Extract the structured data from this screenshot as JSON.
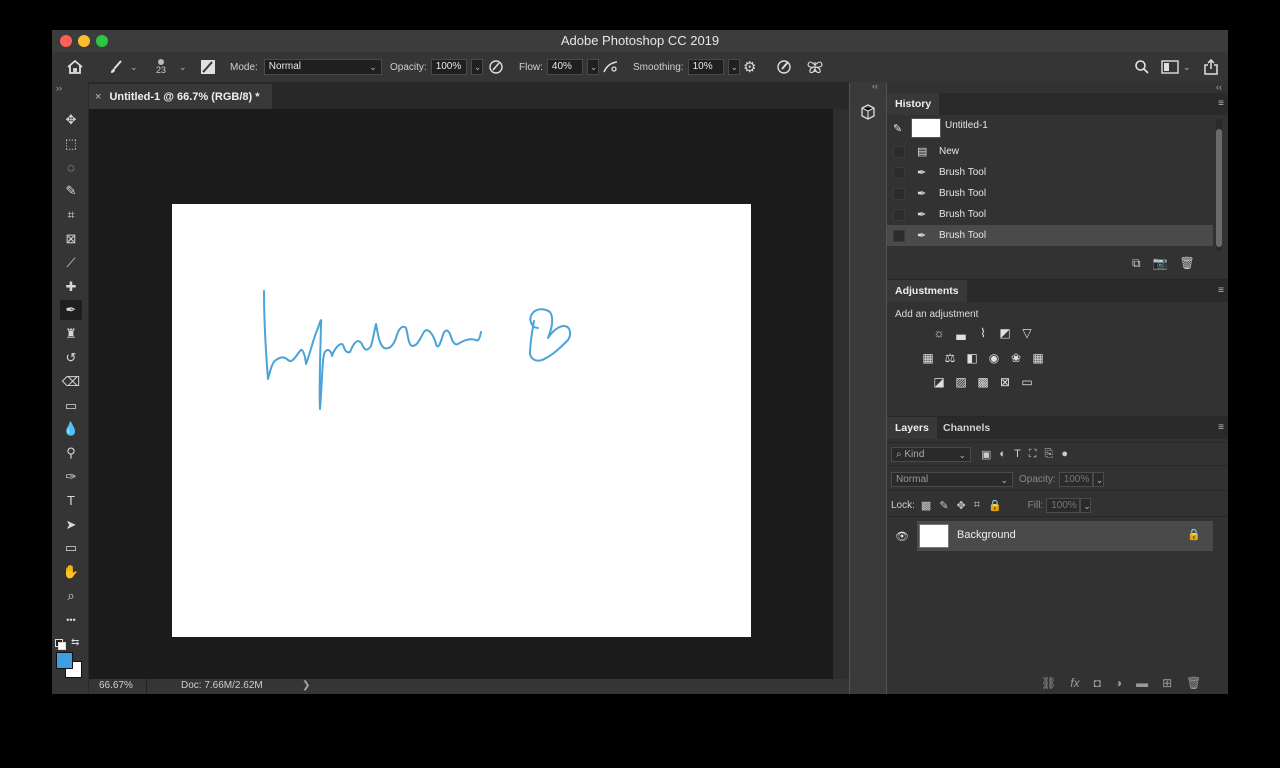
{
  "app": {
    "title": "Adobe Photoshop CC 2019",
    "traffic_lights": {
      "close": "#ff5f57",
      "minimize": "#febc2e",
      "zoom": "#28c840"
    }
  },
  "options_bar": {
    "brush_size": "23",
    "mode_label": "Mode:",
    "mode_value": "Normal",
    "opacity_label": "Opacity:",
    "opacity_value": "100%",
    "flow_label": "Flow:",
    "flow_value": "40%",
    "smoothing_label": "Smoothing:",
    "smoothing_value": "10%"
  },
  "document": {
    "tab_label": "Untitled-1 @ 66.7% (RGB/8) *",
    "tab_close": "×",
    "stroke_color": "#4aa3d9",
    "zoom": "66.67%",
    "doc_info": "Doc: 7.66M/2.62M",
    "status_arrow": "❯"
  },
  "toolbox": {
    "expand": "››",
    "foreground_color": "#3f9ee0",
    "background_color": "#ffffff",
    "tools": [
      {
        "name": "move-tool-icon",
        "glyph": "✥"
      },
      {
        "name": "marquee-tool-icon",
        "glyph": "⬚"
      },
      {
        "name": "lasso-tool-icon",
        "glyph": "◌"
      },
      {
        "name": "quick-select-tool-icon",
        "glyph": "✎"
      },
      {
        "name": "crop-tool-icon",
        "glyph": "⌗"
      },
      {
        "name": "frame-tool-icon",
        "glyph": "⊠"
      },
      {
        "name": "eyedropper-tool-icon",
        "glyph": "⟋"
      },
      {
        "name": "healing-brush-tool-icon",
        "glyph": "✚"
      },
      {
        "name": "brush-tool-icon",
        "glyph": "✒"
      },
      {
        "name": "clone-stamp-tool-icon",
        "glyph": "♜"
      },
      {
        "name": "history-brush-tool-icon",
        "glyph": "↺"
      },
      {
        "name": "eraser-tool-icon",
        "glyph": "⌫"
      },
      {
        "name": "gradient-tool-icon",
        "glyph": "▭"
      },
      {
        "name": "blur-tool-icon",
        "glyph": "💧"
      },
      {
        "name": "dodge-tool-icon",
        "glyph": "⚲"
      },
      {
        "name": "pen-tool-icon",
        "glyph": "✑"
      },
      {
        "name": "type-tool-icon",
        "glyph": "T"
      },
      {
        "name": "path-select-tool-icon",
        "glyph": "➤"
      },
      {
        "name": "rectangle-tool-icon",
        "glyph": "▭"
      },
      {
        "name": "hand-tool-icon",
        "glyph": "✋"
      },
      {
        "name": "zoom-tool-icon",
        "glyph": "⌕"
      },
      {
        "name": "more-tools-icon",
        "glyph": "•••"
      }
    ]
  },
  "panels_collapse": "‹‹",
  "history": {
    "tab": "History",
    "snapshot": "Untitled-1",
    "items": [
      "New",
      "Brush Tool",
      "Brush Tool",
      "Brush Tool",
      "Brush Tool"
    ]
  },
  "adjustments": {
    "tab": "Adjustments",
    "hint": "Add an adjustment"
  },
  "layers": {
    "tab_layers": "Layers",
    "tab_channels": "Channels",
    "filter_kind": "Kind",
    "blend_mode": "Normal",
    "opacity_label": "Opacity:",
    "opacity_value": "100%",
    "lock_label": "Lock:",
    "fill_label": "Fill:",
    "fill_value": "100%",
    "layer_name": "Background"
  }
}
